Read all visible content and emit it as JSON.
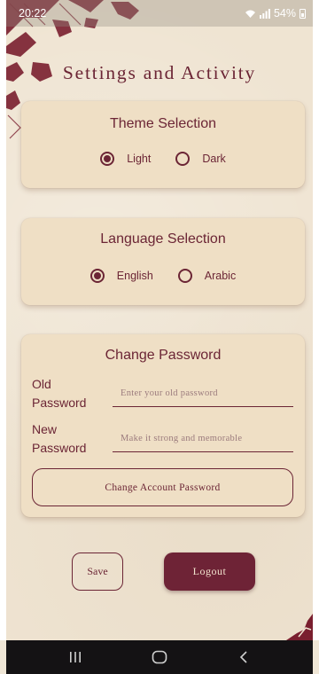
{
  "status_bar": {
    "time": "20:22",
    "battery": "54%"
  },
  "page_title": "Settings and Activity",
  "theme": {
    "title": "Theme Selection",
    "options": [
      {
        "label": "Light",
        "selected": true
      },
      {
        "label": "Dark",
        "selected": false
      }
    ]
  },
  "language": {
    "title": "Language Selection",
    "options": [
      {
        "label": "English",
        "selected": true
      },
      {
        "label": "Arabic",
        "selected": false
      }
    ]
  },
  "password": {
    "title": "Change Password",
    "old_label": "Old Password",
    "old_placeholder": "Enter your old password",
    "new_label": "New Password",
    "new_placeholder": "Make it strong and memorable",
    "change_button": "Change Account Password"
  },
  "actions": {
    "save": "Save",
    "logout": "Logout"
  },
  "nav_bar": {
    "buttons": [
      "recents-icon",
      "home-icon",
      "back-icon"
    ]
  },
  "colors": {
    "accent": "#6e2336",
    "background": "#efe4d2",
    "card": "#efdfc5"
  }
}
